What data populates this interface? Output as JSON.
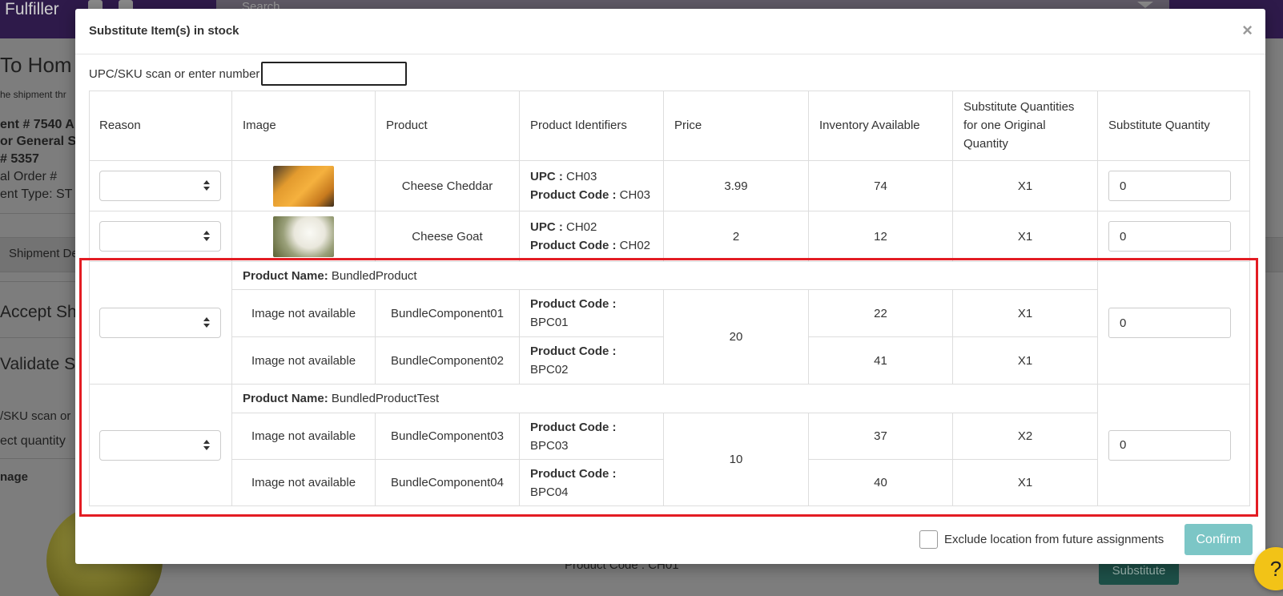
{
  "background": {
    "brand": "Fulfiller",
    "search_placeholder": "Search",
    "fragments": [
      "To Hom",
      "he shipment thr",
      "ent # 7540 A",
      "or General S",
      "# 5357",
      "al Order #",
      "ent Type: ST",
      "Shipment De",
      "Accept Sh",
      "Validate S",
      "/SKU scan or",
      "ect quantity",
      "nage"
    ],
    "product_code_fragment": "Product Code : CH01",
    "substitute_label": "Substitute",
    "help_label": "?"
  },
  "modal": {
    "title": "Substitute Item(s) in stock",
    "close_label": "×",
    "scan_label": "UPC/SKU scan or enter number",
    "scan_value": "",
    "columns": {
      "reason": "Reason",
      "image": "Image",
      "product": "Product",
      "identifiers": "Product Identifiers",
      "price": "Price",
      "inventory": "Inventory Available",
      "sub_per_original": "Substitute Quantities for one Original Quantity",
      "sub_qty": "Substitute Quantity"
    },
    "rows": [
      {
        "product": "Cheese Cheddar",
        "upc_label": "UPC :",
        "upc": "CH03",
        "code_label": "Product Code :",
        "code": "CH03",
        "price": "3.99",
        "inventory": "74",
        "ratio": "X1",
        "qty": "0"
      },
      {
        "product": "Cheese Goat",
        "upc_label": "UPC :",
        "upc": "CH02",
        "code_label": "Product Code :",
        "code": "CH02",
        "price": "2",
        "inventory": "12",
        "ratio": "X1",
        "qty": "0"
      }
    ],
    "bundles": [
      {
        "name_label": "Product Name:",
        "name": "BundledProduct",
        "price": "20",
        "qty": "0",
        "components": [
          {
            "image": "Image not available",
            "product": "BundleComponent01",
            "code_label": "Product Code :",
            "code": "BPC01",
            "inventory": "22",
            "ratio": "X1"
          },
          {
            "image": "Image not available",
            "product": "BundleComponent02",
            "code_label": "Product Code :",
            "code": "BPC02",
            "inventory": "41",
            "ratio": "X1"
          }
        ]
      },
      {
        "name_label": "Product Name:",
        "name": "BundledProductTest",
        "price": "10",
        "qty": "0",
        "components": [
          {
            "image": "Image not available",
            "product": "BundleComponent03",
            "code_label": "Product Code :",
            "code": "BPC03",
            "inventory": "37",
            "ratio": "X2"
          },
          {
            "image": "Image not available",
            "product": "BundleComponent04",
            "code_label": "Product Code :",
            "code": "BPC04",
            "inventory": "40",
            "ratio": "X1"
          }
        ]
      }
    ],
    "exclude_label": "Exclude location from future assignments",
    "exclude_checked": false,
    "confirm_label": "Confirm",
    "highlight_color": "#e31c23",
    "confirm_color": "#7cc6c6"
  }
}
